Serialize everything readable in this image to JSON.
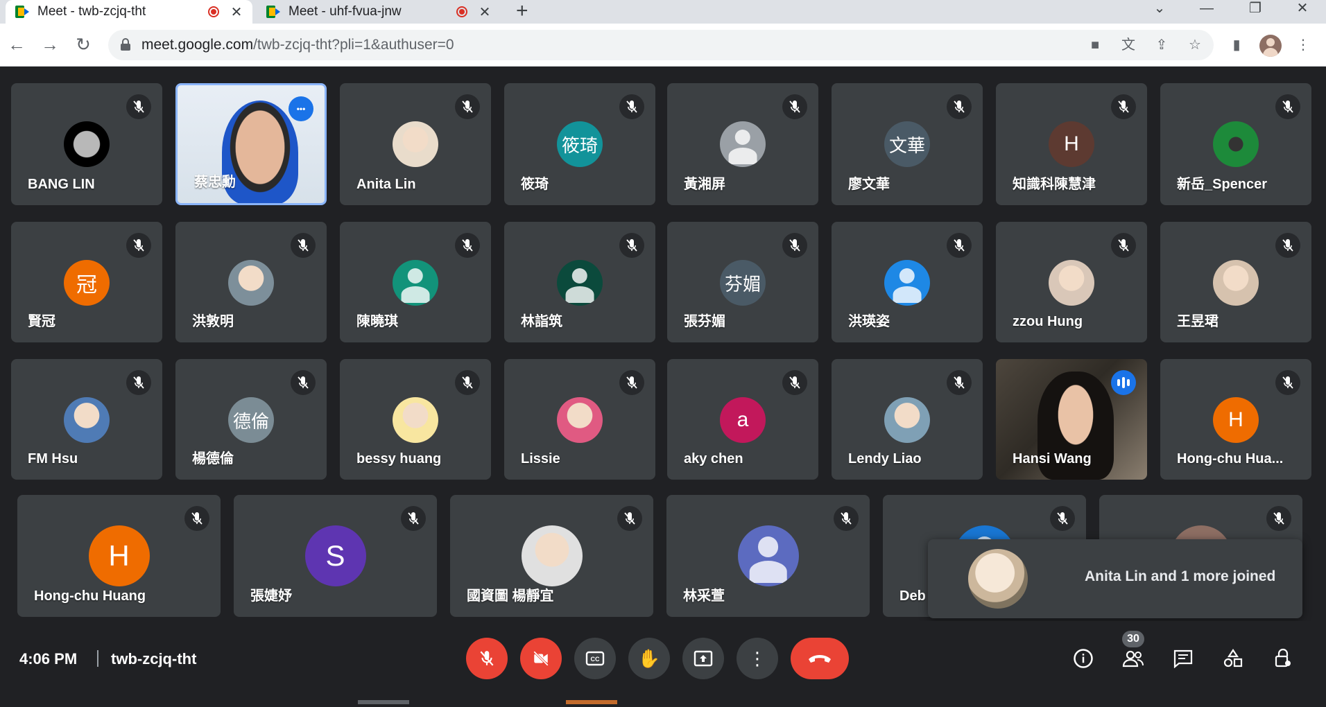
{
  "browser": {
    "tabs": [
      {
        "title": "Meet - twb-zcjq-tht",
        "active": true
      },
      {
        "title": "Meet - uhf-fvua-jnw",
        "active": false
      }
    ],
    "url_host": "meet.google.com",
    "url_path": "/twb-zcjq-tht?pli=1&authuser=0"
  },
  "participants": [
    {
      "name": "BANG LIN",
      "avatar": "",
      "color": "#000000",
      "kind": "moon"
    },
    {
      "name": "蔡忠勳",
      "avatar": "",
      "color": "#e8eef5",
      "kind": "video"
    },
    {
      "name": "Anita Lin",
      "avatar": "",
      "color": "#e9dccb",
      "kind": "photo"
    },
    {
      "name": "筱琦",
      "avatar": "筱琦",
      "color": "#12939a",
      "kind": "initials"
    },
    {
      "name": "黃湘屏",
      "avatar": "",
      "color": "#9aa0a6",
      "kind": "generic"
    },
    {
      "name": "廖文華",
      "avatar": "文華",
      "color": "#4a5a66",
      "kind": "initials"
    },
    {
      "name": "知識科陳慧津",
      "avatar": "H",
      "color": "#5d3a31",
      "kind": "initials"
    },
    {
      "name": "新岳_Spencer",
      "avatar": "",
      "color": "#1d8a3a",
      "kind": "chip"
    },
    {
      "name": "賢冠",
      "avatar": "冠",
      "color": "#ef6c00",
      "kind": "initials"
    },
    {
      "name": "洪敦明",
      "avatar": "",
      "color": "#7d8f9a",
      "kind": "photo"
    },
    {
      "name": "陳曉琪",
      "avatar": "",
      "color": "#12937a",
      "kind": "generic"
    },
    {
      "name": "林詣筑",
      "avatar": "",
      "color": "#0b4a3c",
      "kind": "generic"
    },
    {
      "name": "張芬媚",
      "avatar": "芬媚",
      "color": "#4a5a66",
      "kind": "initials"
    },
    {
      "name": "洪瑛姿",
      "avatar": "",
      "color": "#1e88e5",
      "kind": "generic"
    },
    {
      "name": "zzou Hung",
      "avatar": "",
      "color": "#d9c7b8",
      "kind": "photo"
    },
    {
      "name": "王昱珺",
      "avatar": "",
      "color": "#d6c2ae",
      "kind": "photo"
    },
    {
      "name": "FM Hsu",
      "avatar": "",
      "color": "#4f7bb5",
      "kind": "photo"
    },
    {
      "name": "楊德倫",
      "avatar": "德倫",
      "color": "#7b8c95",
      "kind": "initials"
    },
    {
      "name": "bessy huang",
      "avatar": "",
      "color": "#f8e6a0",
      "kind": "photo"
    },
    {
      "name": "Lissie",
      "avatar": "",
      "color": "#e05a82",
      "kind": "photo"
    },
    {
      "name": "aky chen",
      "avatar": "a",
      "color": "#c2185b",
      "kind": "initials"
    },
    {
      "name": "Lendy Liao",
      "avatar": "",
      "color": "#7fa0b5",
      "kind": "photo"
    },
    {
      "name": "Hansi Wang",
      "avatar": "",
      "color": "#4d463d",
      "kind": "video"
    },
    {
      "name": "Hong-chu Hua...",
      "avatar": "H",
      "color": "#ef6c00",
      "kind": "initials"
    },
    {
      "name": "Hong-chu Huang",
      "avatar": "H",
      "color": "#ef6c00",
      "kind": "initials"
    },
    {
      "name": "張婕妤",
      "avatar": "S",
      "color": "#5e35b1",
      "kind": "initials"
    },
    {
      "name": "國資圖 楊靜宜",
      "avatar": "",
      "color": "#e0e0e0",
      "kind": "photo"
    },
    {
      "name": "林采萱",
      "avatar": "",
      "color": "#5c6bc0",
      "kind": "generic"
    },
    {
      "name": "Deb",
      "avatar": "",
      "color": "#1976d2",
      "kind": "generic"
    }
  ],
  "toast": {
    "text": "Anita Lin and 1 more joined"
  },
  "bottom": {
    "time": "4:06 PM",
    "meeting_code": "twb-zcjq-tht",
    "people_count": "30"
  },
  "colors": {
    "end_call": "#ea4335",
    "accent": "#1a73e8"
  }
}
